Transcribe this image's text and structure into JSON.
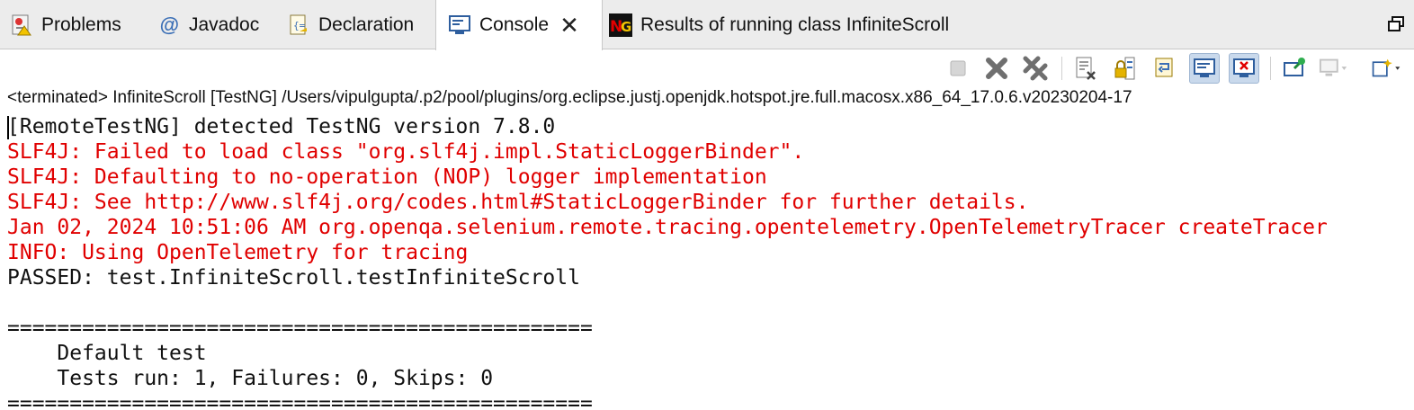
{
  "tabs": [
    {
      "label": "Problems",
      "icon": "problems-icon"
    },
    {
      "label": "Javadoc",
      "icon": "javadoc-icon"
    },
    {
      "label": "Declaration",
      "icon": "declaration-icon"
    },
    {
      "label": "Console",
      "icon": "console-icon",
      "active": true
    },
    {
      "label": "Results of running class InfiniteScroll",
      "icon": "testng-icon"
    }
  ],
  "status_line": "<terminated> InfiniteScroll [TestNG] /Users/vipulgupta/.p2/pool/plugins/org.eclipse.justj.openjdk.hotspot.jre.full.macosx.x86_64_17.0.6.v20230204-17",
  "console": {
    "lines": [
      {
        "text": "[RemoteTestNG] detected TestNG version 7.8.0",
        "color": "#111111"
      },
      {
        "text": "SLF4J: Failed to load class \"org.slf4j.impl.StaticLoggerBinder\".",
        "color": "#e00000"
      },
      {
        "text": "SLF4J: Defaulting to no-operation (NOP) logger implementation",
        "color": "#e00000"
      },
      {
        "text": "SLF4J: See http://www.slf4j.org/codes.html#StaticLoggerBinder for further details.",
        "color": "#e00000"
      },
      {
        "text": "Jan 02, 2024 10:51:06 AM org.openqa.selenium.remote.tracing.opentelemetry.OpenTelemetryTracer createTracer",
        "color": "#e00000"
      },
      {
        "text": "INFO: Using OpenTelemetry for tracing",
        "color": "#e00000"
      },
      {
        "text": "PASSED: test.InfiniteScroll.testInfiniteScroll",
        "color": "#111111"
      },
      {
        "text": "",
        "color": "#111111"
      },
      {
        "text": "===============================================",
        "color": "#111111"
      },
      {
        "text": "    Default test",
        "color": "#111111"
      },
      {
        "text": "    Tests run: 1, Failures: 0, Skips: 0",
        "color": "#111111"
      },
      {
        "text": "===============================================",
        "color": "#111111"
      }
    ]
  },
  "colors": {
    "error": "#e00000",
    "normal": "#111111",
    "accent": "#3b6fb6"
  }
}
